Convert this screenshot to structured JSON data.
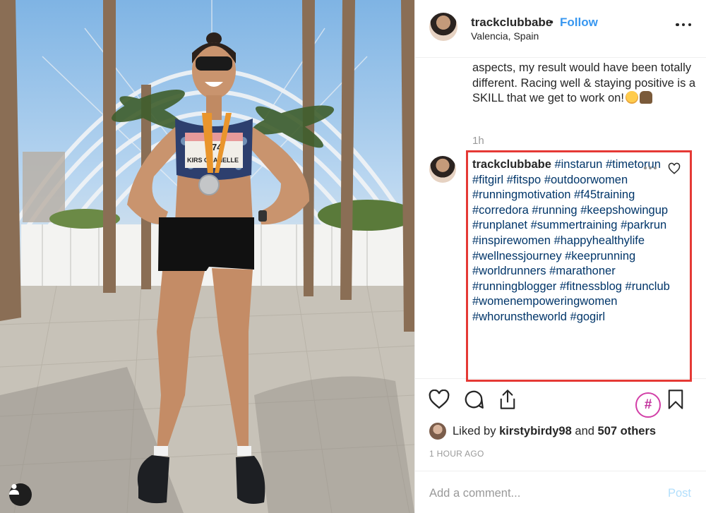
{
  "post": {
    "username": "trackclubbabe",
    "separator": "•",
    "follow_label": "Follow",
    "location": "Valencia, Spain"
  },
  "caption_tail": "aspects, my result would have been totally different. Racing well & staying positive is a SKILL that we get to work on!",
  "caption_time": "1h",
  "comment": {
    "username": "trackclubbabe",
    "hashtags": [
      "#instarun",
      "#timetorun",
      "#fitgirl",
      "#fitspo",
      "#outdoorwomen",
      "#runningmotivation",
      "#f45training",
      "#corredora",
      "#running",
      "#keepshowingup",
      "#runplanet",
      "#summertraining",
      "#parkrun",
      "#inspirewomen",
      "#happyhealthylife",
      "#wellnessjourney",
      "#keeprunning",
      "#worldrunners",
      "#marathoner",
      "#runningblogger",
      "#fitnessblog",
      "#runclub",
      "#womenempoweringwomen",
      "#whorunstheworld",
      "#gogirl"
    ]
  },
  "likes": {
    "prefix": "Liked by",
    "user": "kirstybirdy98",
    "joiner": "and",
    "others": "507 others"
  },
  "timestamp": "1 HOUR AGO",
  "add_comment": {
    "placeholder": "Add a comment...",
    "post_label": "Post"
  },
  "icons": {
    "more": "more-horizontal-icon",
    "like": "heart-icon",
    "comment": "comment-bubble-icon",
    "share": "share-upload-icon",
    "hashtag": "hashtag-icon",
    "save": "bookmark-icon",
    "user_tags": "user-icon"
  },
  "colors": {
    "link_blue": "#3897f0",
    "hashtag_blue": "#003569",
    "highlight_red": "#e53935",
    "muted": "#999999",
    "hashtag_pink": "#d23fa7"
  }
}
